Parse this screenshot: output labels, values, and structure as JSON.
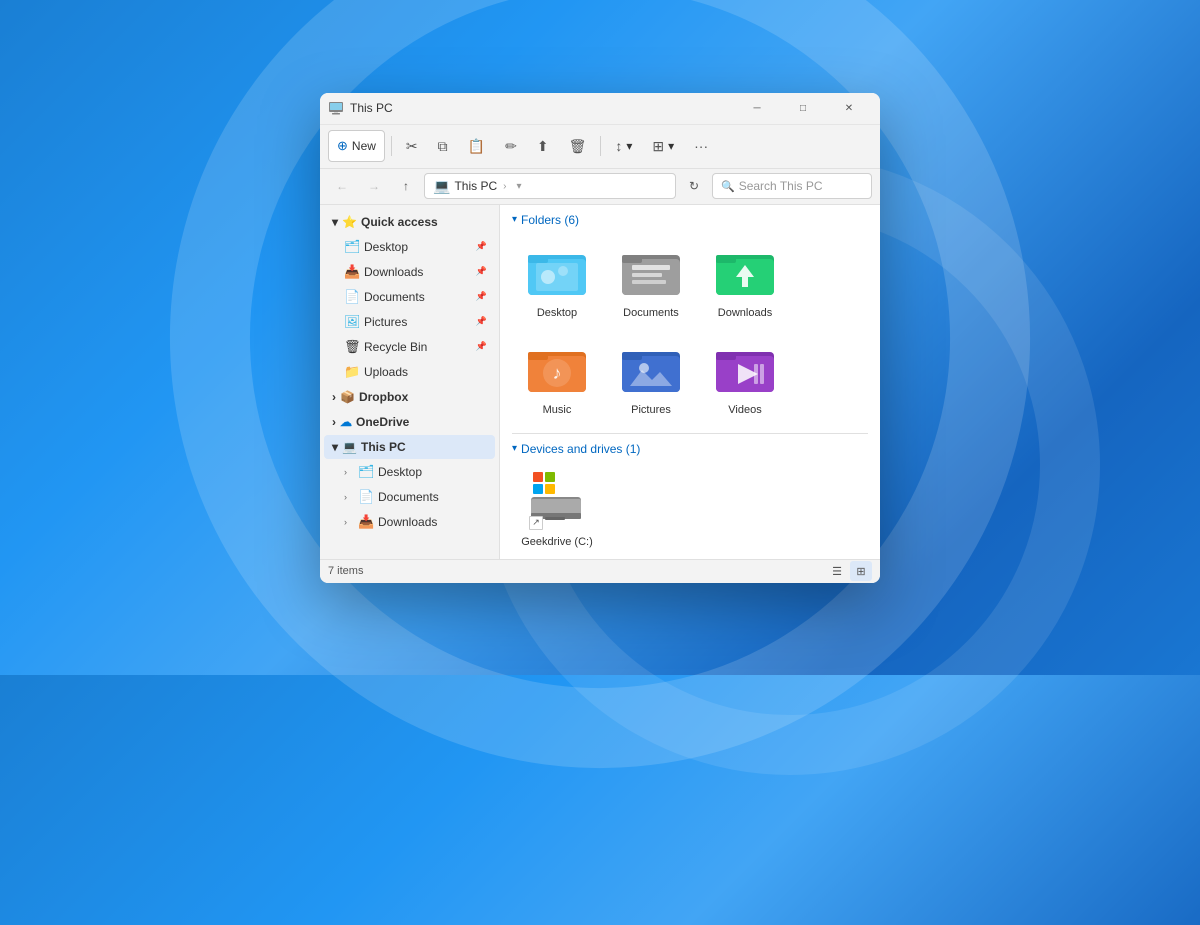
{
  "window": {
    "title": "This PC",
    "icon": "computer"
  },
  "controls": {
    "minimize": "─",
    "maximize": "□",
    "close": "✕"
  },
  "toolbar": {
    "new_label": "New",
    "buttons": [
      "cut",
      "copy",
      "paste",
      "rename",
      "share",
      "delete",
      "sort",
      "display",
      "more"
    ]
  },
  "addressbar": {
    "back": "←",
    "forward": "→",
    "up": "↑",
    "location_icon": "💻",
    "location_parts": [
      "This PC"
    ],
    "refresh": "↻",
    "search_placeholder": "Search This PC"
  },
  "sidebar": {
    "sections": [
      {
        "id": "quick-access",
        "label": "Quick access",
        "icon": "⭐",
        "expanded": true,
        "items": [
          {
            "label": "Desktop",
            "icon": "🗂",
            "pinned": true
          },
          {
            "label": "Downloads",
            "icon": "📥",
            "pinned": true
          },
          {
            "label": "Documents",
            "icon": "📄",
            "pinned": true
          },
          {
            "label": "Pictures",
            "icon": "🖼",
            "pinned": true
          },
          {
            "label": "Recycle Bin",
            "icon": "🗑",
            "pinned": true
          },
          {
            "label": "Uploads",
            "icon": "📁",
            "pinned": false
          }
        ]
      },
      {
        "id": "dropbox",
        "label": "Dropbox",
        "icon": "📦",
        "expanded": false
      },
      {
        "id": "onedrive",
        "label": "OneDrive",
        "icon": "☁",
        "expanded": false
      },
      {
        "id": "this-pc",
        "label": "This PC",
        "icon": "💻",
        "expanded": true,
        "active": true,
        "items": [
          {
            "label": "Desktop",
            "icon": "🗂"
          },
          {
            "label": "Documents",
            "icon": "📄"
          },
          {
            "label": "Downloads",
            "icon": "📥"
          }
        ]
      }
    ]
  },
  "content": {
    "folders_section": {
      "label": "Folders",
      "count": 6,
      "expanded": true,
      "items": [
        {
          "id": "desktop",
          "label": "Desktop"
        },
        {
          "id": "documents",
          "label": "Documents"
        },
        {
          "id": "downloads",
          "label": "Downloads"
        },
        {
          "id": "music",
          "label": "Music"
        },
        {
          "id": "pictures",
          "label": "Pictures"
        },
        {
          "id": "videos",
          "label": "Videos"
        }
      ]
    },
    "drives_section": {
      "label": "Devices and drives",
      "count": 1,
      "expanded": true,
      "items": [
        {
          "id": "c-drive",
          "label": "Geekdrive (C:)"
        }
      ]
    }
  },
  "statusbar": {
    "item_count": "7 items"
  }
}
